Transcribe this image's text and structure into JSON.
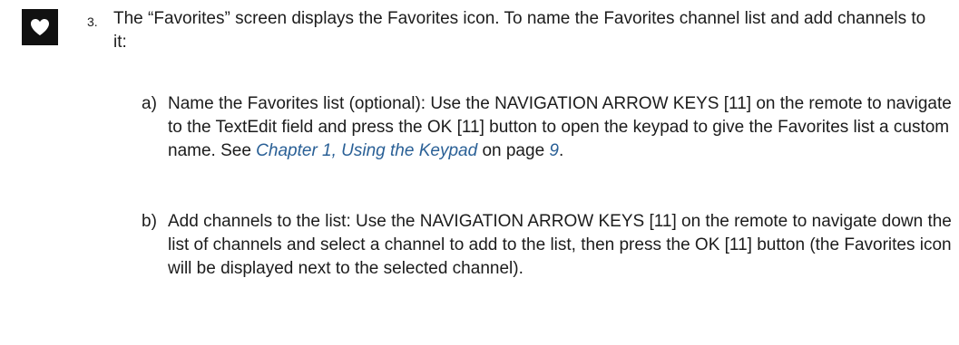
{
  "icon": {
    "name": "heart-icon",
    "background": "#111111",
    "color": "#ffffff"
  },
  "step": {
    "number": "3.",
    "text": "The “Favorites” screen displays the Favorites icon. To name the Favorites channel list and add channels to it:"
  },
  "substeps": [
    {
      "label": "a)",
      "text_before": "Name the Favorites list (optional): Use the NAVIGATION ARROW KEYS [11] on the remote to navigate to the TextEdit field and press the OK [11] button to open the keypad to give the Favorites list a custom name. See ",
      "link_text": "Chapter 1, Using the Keypad",
      "text_middle": " on page ",
      "page_ref": "9",
      "text_after": "."
    },
    {
      "label": "b)",
      "text": "Add channels to the list: Use the NAVIGATION ARROW KEYS [11] on the remote to navigate down the list of channels and select a channel to add to the list, then press the OK [11] button (the Favorites icon will be displayed next to the selected channel)."
    }
  ],
  "colors": {
    "text": "#1c1c1c",
    "link": "#2a6096"
  }
}
